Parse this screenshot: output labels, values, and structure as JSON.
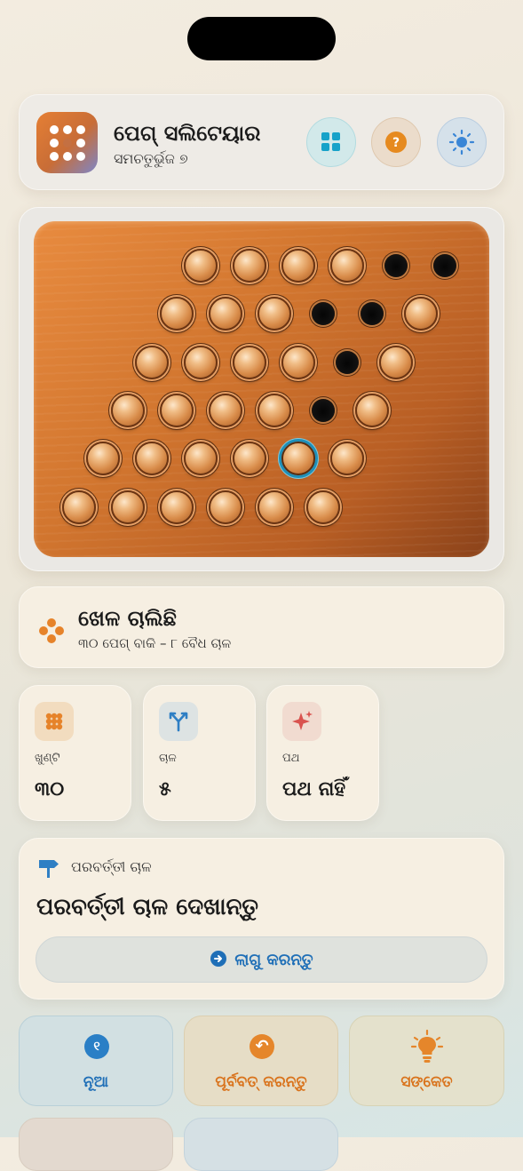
{
  "app": {
    "title": "ପେଗ୍ ସଲିଟେୟାର",
    "subtitle": "ସମଚତୁର୍ଭୁଜ ୭",
    "icon": "peg-grid-icon",
    "header_buttons": [
      {
        "name": "layout",
        "icon": "grid-icon",
        "color": "#1aa3c8"
      },
      {
        "name": "help",
        "icon": "question-icon",
        "color": "#e68a1f"
      },
      {
        "name": "theme",
        "icon": "sun-icon",
        "color": "#3a86d6"
      }
    ]
  },
  "board": {
    "rows": [
      "PPPPHH",
      "PPPHHP",
      "PPPPHP",
      "PPPPHP",
      "PPPPSP",
      "PPPPPP"
    ],
    "selected_color": "#1f8fb8"
  },
  "status": {
    "title": "ଖେଳ ଚାଲିଛି",
    "subtitle": "୩୦ ପେଗ୍ ବାକି – ୮ ବୈଧ ଚାଳ",
    "icon": "pegs-cluster-icon"
  },
  "stats": [
    {
      "label": "ଖୁଣ୍ଟି",
      "value": "୩୦",
      "icon": "pegs-icon",
      "icon_bg": "#f2dcbf",
      "icon_color": "#e6832a"
    },
    {
      "label": "ଚାଳ",
      "value": "୫",
      "icon": "branch-icon",
      "icon_bg": "#dde3e3",
      "icon_color": "#2f7fc4"
    },
    {
      "label": "ପଥ",
      "value": "ପଥ ନାହିଁ",
      "icon": "sparkle-icon",
      "icon_bg": "#f1dbd0",
      "icon_color": "#d9534f"
    }
  ],
  "next_move": {
    "label": "ପରବର୍ତ୍ତୀ ଚାଳ",
    "title": "ପରବର୍ତ୍ତୀ ଚାଳ ଦେଖାନ୍ତୁ",
    "apply_label": "ଲାଗୁ କରନ୍ତୁ",
    "icon": "signpost-icon"
  },
  "actions": [
    {
      "label": "ନୂଆ",
      "icon": "new-game-icon",
      "glyph": "୧",
      "color": "#2a7fc6",
      "text_color": "#1f6fb7"
    },
    {
      "label": "ପୂର୍ବବତ୍ କରନ୍ତୁ",
      "icon": "undo-icon",
      "glyph": "↶",
      "color": "#e5862b",
      "text_color": "#d9731c"
    },
    {
      "label": "ସଙ୍କେତ",
      "icon": "lightbulb-icon",
      "glyph": "",
      "color": "#e5862b",
      "text_color": "#d9731c"
    }
  ]
}
